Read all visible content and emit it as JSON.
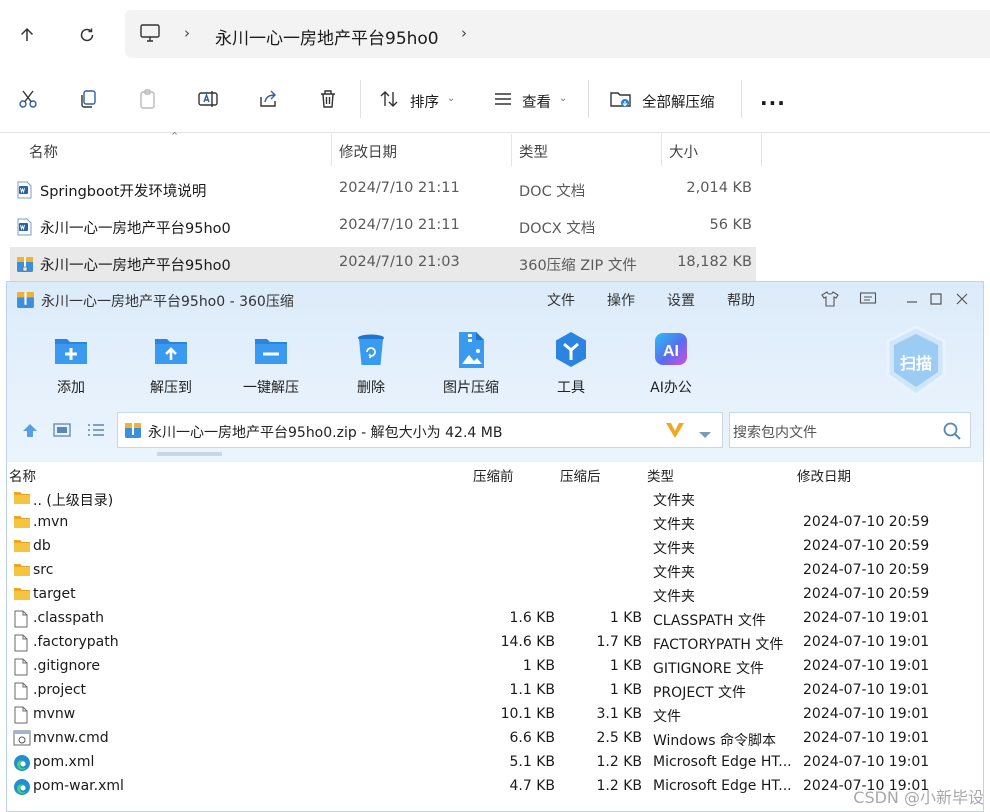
{
  "explorer": {
    "breadcrumb": [
      "永川一心一房地产平台95ho0"
    ],
    "toolbar": {
      "sort_label": "排序",
      "view_label": "查看",
      "extract_all_label": "全部解压缩",
      "more_label": "..."
    },
    "columns": {
      "name": "名称",
      "date": "修改日期",
      "type": "类型",
      "size": "大小"
    },
    "files": [
      {
        "name": "Springboot开发环境说明",
        "date": "2024/7/10 21:11",
        "type": "DOC 文档",
        "size": "2,014 KB",
        "icon": "word-doc-icon"
      },
      {
        "name": "永川一心一房地产平台95ho0",
        "date": "2024/7/10 21:11",
        "type": "DOCX 文档",
        "size": "56 KB",
        "icon": "word-doc-icon"
      },
      {
        "name": "永川一心一房地产平台95ho0",
        "date": "2024/7/10 21:03",
        "type": "360压缩 ZIP 文件",
        "size": "18,182 KB",
        "icon": "zip-archive-icon"
      }
    ]
  },
  "zip_window": {
    "title": "永川一心一房地产平台95ho0 - 360压缩",
    "menu": [
      "文件",
      "操作",
      "设置",
      "帮助"
    ],
    "tools": [
      {
        "label": "添加",
        "icon": "add-icon"
      },
      {
        "label": "解压到",
        "icon": "extract-to-icon"
      },
      {
        "label": "一键解压",
        "icon": "one-click-extract-icon"
      },
      {
        "label": "删除",
        "icon": "delete-icon"
      },
      {
        "label": "图片压缩",
        "icon": "image-compress-icon"
      },
      {
        "label": "工具",
        "icon": "tools-icon"
      },
      {
        "label": "AI办公",
        "icon": "ai-office-icon"
      }
    ],
    "scan_label": "扫描",
    "path": "永川一心一房地产平台95ho0.zip - 解包大小为 42.4 MB",
    "search_placeholder": "搜索包内文件",
    "columns": {
      "name": "名称",
      "before": "压缩前",
      "after": "压缩后",
      "type": "类型",
      "date": "修改日期"
    },
    "rows": [
      {
        "name": ".. (上级目录)",
        "before": "",
        "after": "",
        "type": "文件夹",
        "date": "",
        "icon": "folder-icon"
      },
      {
        "name": ".mvn",
        "before": "",
        "after": "",
        "type": "文件夹",
        "date": "2024-07-10 20:59",
        "icon": "folder-icon"
      },
      {
        "name": "db",
        "before": "",
        "after": "",
        "type": "文件夹",
        "date": "2024-07-10 20:59",
        "icon": "folder-icon"
      },
      {
        "name": "src",
        "before": "",
        "after": "",
        "type": "文件夹",
        "date": "2024-07-10 20:59",
        "icon": "folder-icon"
      },
      {
        "name": "target",
        "before": "",
        "after": "",
        "type": "文件夹",
        "date": "2024-07-10 20:59",
        "icon": "folder-icon"
      },
      {
        "name": ".classpath",
        "before": "1.6 KB",
        "after": "1 KB",
        "type": "CLASSPATH 文件",
        "date": "2024-07-10 19:01",
        "icon": "file-icon"
      },
      {
        "name": ".factorypath",
        "before": "14.6 KB",
        "after": "1.7 KB",
        "type": "FACTORYPATH 文件",
        "date": "2024-07-10 19:01",
        "icon": "file-icon"
      },
      {
        "name": ".gitignore",
        "before": "1 KB",
        "after": "1 KB",
        "type": "GITIGNORE 文件",
        "date": "2024-07-10 19:01",
        "icon": "file-icon"
      },
      {
        "name": ".project",
        "before": "1.1 KB",
        "after": "1 KB",
        "type": "PROJECT 文件",
        "date": "2024-07-10 19:01",
        "icon": "file-icon"
      },
      {
        "name": "mvnw",
        "before": "10.1 KB",
        "after": "3.1 KB",
        "type": "文件",
        "date": "2024-07-10 19:01",
        "icon": "file-icon"
      },
      {
        "name": "mvnw.cmd",
        "before": "6.6 KB",
        "after": "2.5 KB",
        "type": "Windows 命令脚本",
        "date": "2024-07-10 19:01",
        "icon": "cmd-script-icon"
      },
      {
        "name": "pom.xml",
        "before": "5.1 KB",
        "after": "1.2 KB",
        "type": "Microsoft Edge HT...",
        "date": "2024-07-10 19:01",
        "icon": "edge-icon"
      },
      {
        "name": "pom-war.xml",
        "before": "4.7 KB",
        "after": "1.2 KB",
        "type": "Microsoft Edge HT...",
        "date": "2024-07-10 19:01",
        "icon": "edge-icon"
      }
    ]
  },
  "watermark": "CSDN @小新毕设"
}
